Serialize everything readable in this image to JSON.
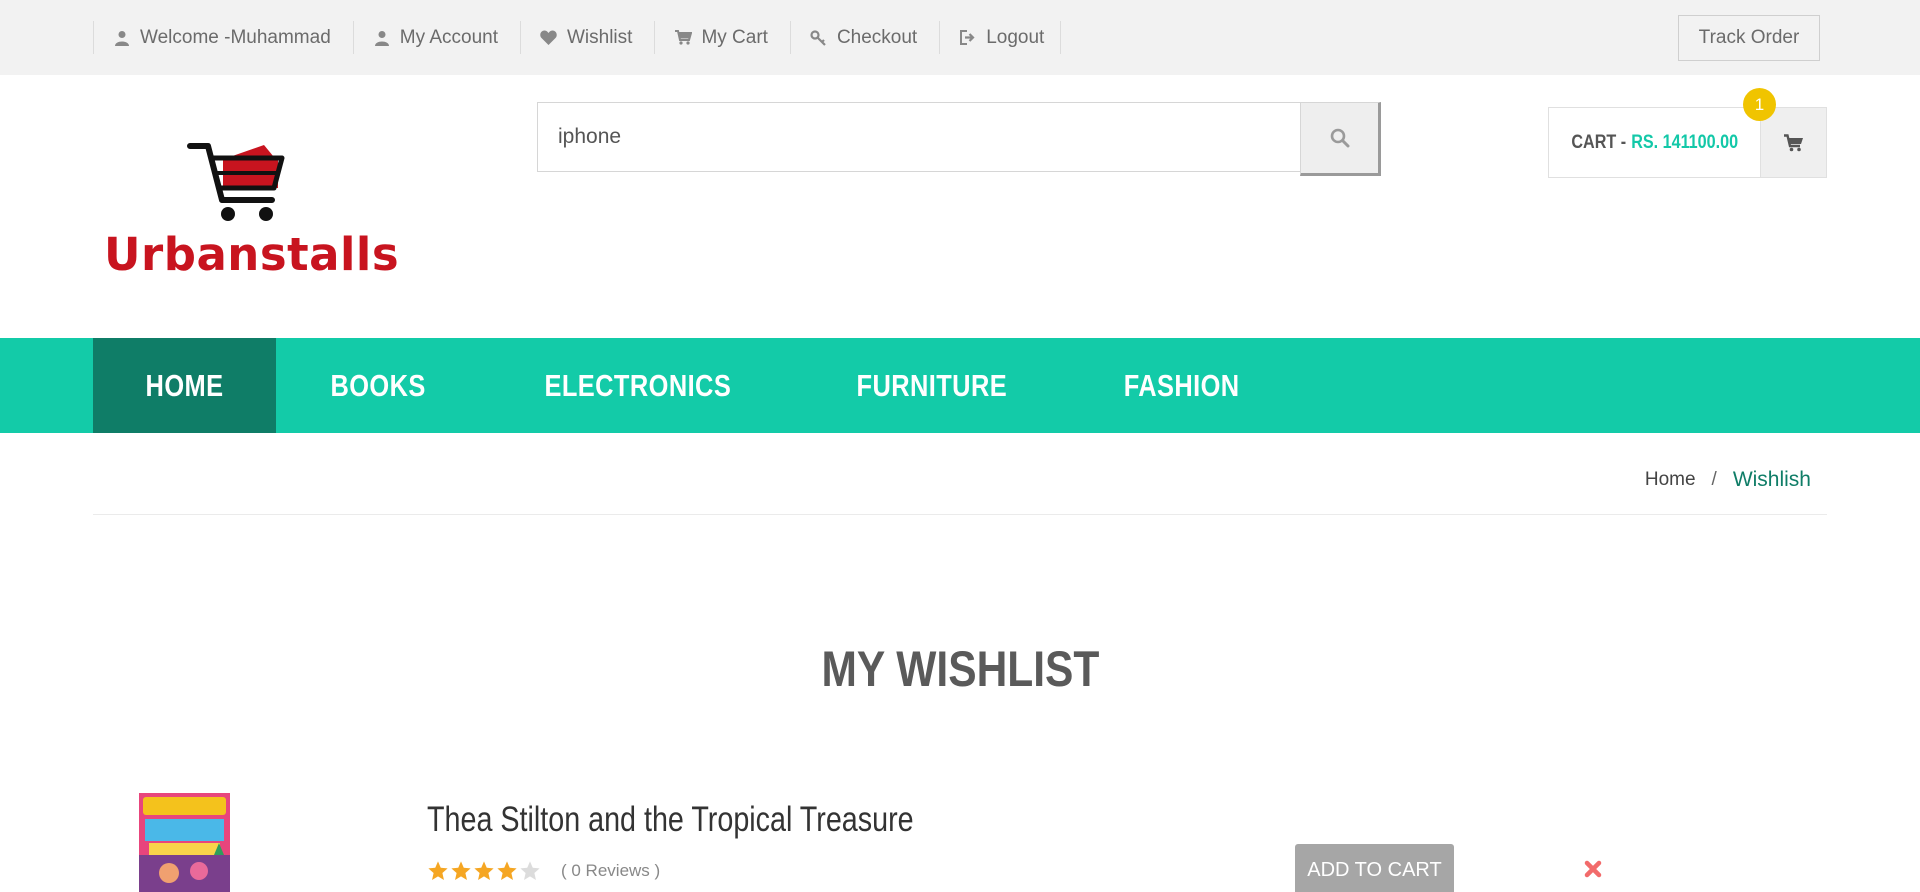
{
  "topbar": {
    "links": [
      {
        "label": "Welcome -Muhammad",
        "icon": "user-icon"
      },
      {
        "label": "My Account",
        "icon": "user-icon"
      },
      {
        "label": "Wishlist",
        "icon": "heart-icon"
      },
      {
        "label": "My Cart",
        "icon": "cart-icon"
      },
      {
        "label": "Checkout",
        "icon": "key-icon"
      },
      {
        "label": "Logout",
        "icon": "logout-icon"
      }
    ],
    "track_order": "Track Order"
  },
  "header": {
    "logo_text": "Urbanstalls",
    "search": {
      "value": "iphone",
      "icon": "search-icon"
    },
    "cart": {
      "label": "CART -",
      "amount": "RS. 141100.00",
      "count": "1",
      "icon": "cart-icon"
    }
  },
  "mainnav": {
    "items": [
      {
        "label": "HOME",
        "active": true
      },
      {
        "label": "BOOKS",
        "active": false
      },
      {
        "label": "ELECTRONICS",
        "active": false
      },
      {
        "label": "FURNITURE",
        "active": false
      },
      {
        "label": "FASHION",
        "active": false
      }
    ]
  },
  "breadcrumb": {
    "home": "Home",
    "separator": "/",
    "current": "Wishlish"
  },
  "page": {
    "title": "MY WISHLIST"
  },
  "wishlist": {
    "items": [
      {
        "name": "Thea Stilton and the Tropical Treasure",
        "rating": 4,
        "max_rating": 5,
        "reviews": "( 0 Reviews )",
        "add_to_cart": "ADD TO CART",
        "remove_icon": "close-icon"
      }
    ]
  },
  "colors": {
    "accent": "#13cba8",
    "nav_active": "#0f7d67",
    "badge": "#f0c400",
    "logo_red": "#c8141f",
    "star": "#f5a623",
    "remove": "#f26b6b"
  }
}
